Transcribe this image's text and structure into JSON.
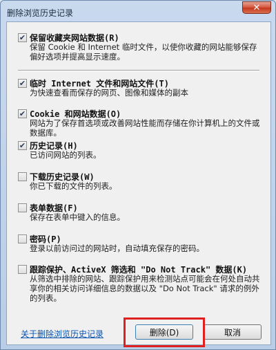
{
  "dialog": {
    "title": "删除浏览历史记录",
    "close_icon": "close-icon",
    "close_glyph": "✕"
  },
  "options": [
    {
      "checked": true,
      "label": "保留收藏夹网站数据(R)",
      "desc": "保留 Cookie 和 Internet 临时文件，以使你收藏的网站能够保存偏好选项并提高显示速度。"
    },
    {
      "checked": true,
      "label": "临时 Internet 文件和网站文件(T)",
      "desc": "为快速查看而保存的网页、图像和媒体的副本"
    },
    {
      "checked": true,
      "label": "Cookie 和网站数据(O)",
      "desc": "网站为了保存首选项或改善网站性能而存储在你计算机上的文件或数据库。"
    },
    {
      "checked": true,
      "label": "历史记录(H)",
      "desc": "已访问网站的列表。"
    },
    {
      "checked": false,
      "label": "下载历史记录(W)",
      "desc": "你已下载的文件的列表。"
    },
    {
      "checked": false,
      "label": "表单数据(F)",
      "desc": "保存在表单中键入的信息。"
    },
    {
      "checked": false,
      "label": "密码(P)",
      "desc": "登录以前访问过的网站时，自动填充保存的密码。"
    },
    {
      "checked": false,
      "label": "跟踪保护、ActiveX 筛选和 \"Do Not Track\" 数据(K)",
      "desc": "从筛选中排除的网站、跟踪保护用来检测站点可能会在何处自动共享你的相关访问详细信息的数据以及 \"Do Not Track\" 请求的例外的列表。"
    }
  ],
  "footer": {
    "help_link": "关于删除浏览历史记录",
    "delete_label": "删除(D)",
    "cancel_label": "取消"
  },
  "colors": {
    "highlight": "#e0201f",
    "link": "#0a54b0"
  }
}
